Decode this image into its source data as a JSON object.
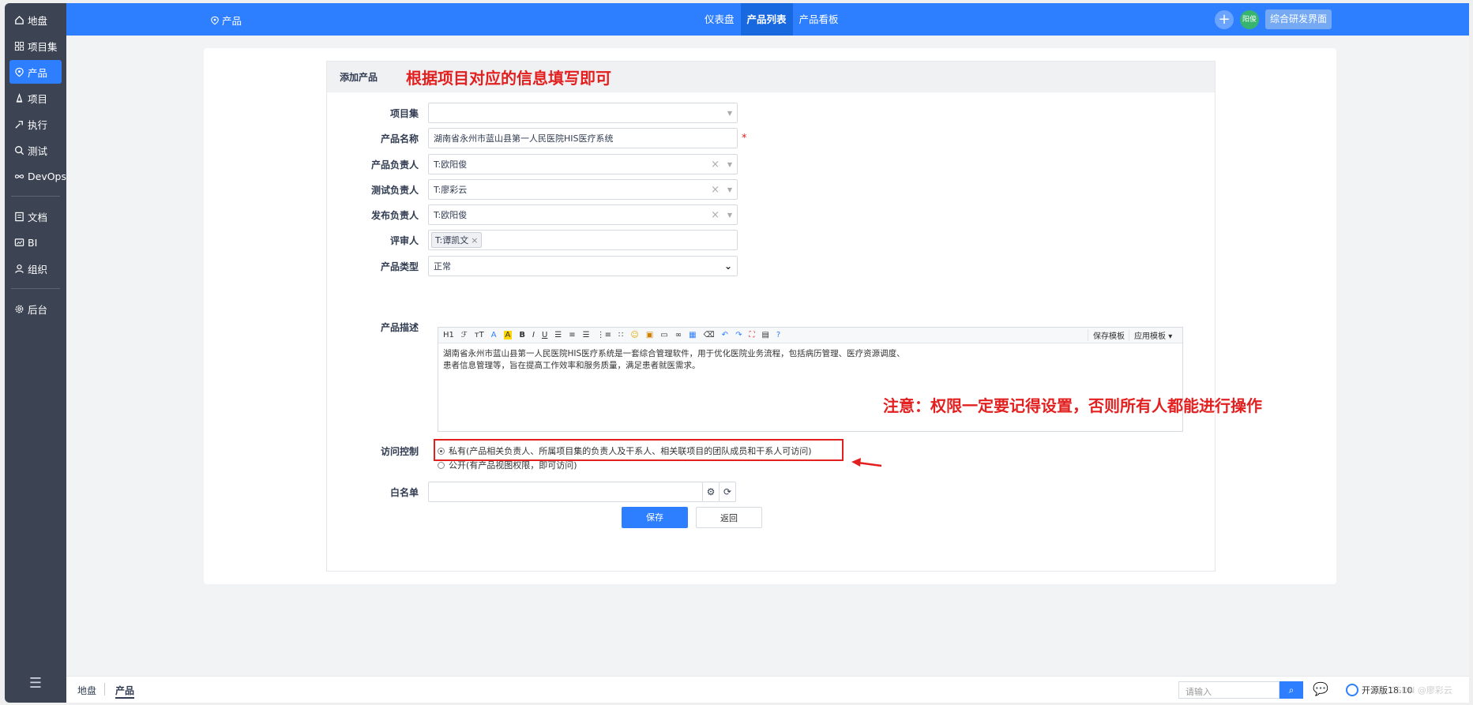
{
  "sidebar": {
    "items": [
      {
        "label": "地盘",
        "icon": "home-icon"
      },
      {
        "label": "项目集",
        "icon": "grid-icon"
      },
      {
        "label": "产品",
        "icon": "product-icon"
      },
      {
        "label": "项目",
        "icon": "project-icon"
      },
      {
        "label": "执行",
        "icon": "execute-icon"
      },
      {
        "label": "测试",
        "icon": "test-icon"
      },
      {
        "label": "DevOps",
        "icon": "infinity-icon"
      },
      {
        "label": "文档",
        "icon": "document-icon"
      },
      {
        "label": "BI",
        "icon": "bi-icon"
      },
      {
        "label": "组织",
        "icon": "org-icon"
      },
      {
        "label": "后台",
        "icon": "gear-icon"
      }
    ],
    "toggle": "☰"
  },
  "header": {
    "title": "产品",
    "tabs": [
      "仪表盘",
      "产品列表",
      "产品看板"
    ],
    "active_tab": "产品列表",
    "plus": "+",
    "avatar": "阳俊",
    "switch_label": "综合研发界面",
    "accent": "#2e7fff"
  },
  "panel": {
    "title": "添加产品",
    "note": "根据项目对应的信息填写即可"
  },
  "form": {
    "program_label": "项目集",
    "program_value": "",
    "name_label": "产品名称",
    "name_value": "湖南省永州市蓝山县第一人民医院HIS医疗系统",
    "required_mark": "*",
    "owner_label": "产品负责人",
    "owner_value": "T:欧阳俊",
    "qa_label": "测试负责人",
    "qa_value": "T:廖彩云",
    "release_label": "发布负责人",
    "release_value": "T:欧阳俊",
    "reviewer_label": "评审人",
    "reviewer_tag": "T:谭凯文",
    "type_label": "产品类型",
    "type_value": "正常",
    "desc_label": "产品描述",
    "desc_value": "湖南省永州市蓝山县第一人民医院HIS医疗系统是一套综合管理软件，用于优化医院业务流程，包括病历管理、医疗资源调度、患者信息管理等，旨在提高工作效率和服务质量，满足患者就医需求。",
    "toolbar": {
      "h1": "H1",
      "font": "ℱ",
      "size": "тT",
      "fore": "A",
      "back": "A",
      "bold": "B",
      "italic": "I",
      "underline": "U",
      "save_template": "保存模板",
      "apply_template": "应用模板"
    },
    "access_label": "访问控制",
    "access_private": "私有(产品相关负责人、所属项目集的负责人及干系人、相关联项目的团队成员和干系人可访问)",
    "access_public": "公开(有产品视图权限，即可访问)",
    "whitelist_label": "白名单",
    "save_button": "保存",
    "back_button": "返回"
  },
  "annotation": {
    "text": "注意：权限一定要记得设置，否则所有人都能进行操作",
    "color": "#e32020"
  },
  "footer": {
    "crumbs": [
      "地盘",
      "产品"
    ],
    "search_placeholder": "请输入",
    "brand": "开源版18.10",
    "watermark": "CSDN @廖彩云"
  }
}
